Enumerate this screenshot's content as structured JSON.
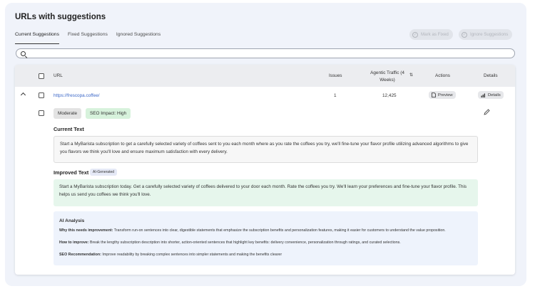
{
  "page": {
    "title": "URLs with suggestions"
  },
  "tabs": [
    "Current Suggestions",
    "Fixed Suggestions",
    "Ignored Suggestions"
  ],
  "actions": {
    "mark_fixed": "Mark as Fixed",
    "ignore": "Ignore Suggestions"
  },
  "table": {
    "columns": {
      "url": "URL",
      "issues": "Issues",
      "traffic_line1": "Agentic Traffic (4",
      "traffic_line2": "Weeks)",
      "actions": "Actions",
      "details": "Details"
    },
    "row": {
      "url": "https://frescopa.coffee/",
      "issues": "1",
      "traffic": "12,425",
      "preview": "Preview",
      "details": "Details"
    }
  },
  "expanded": {
    "severity": "Moderate",
    "impact": "SEO Impact: High",
    "current_heading": "Current Text",
    "current_text": "Start a MyBarista subscription to get a carefully selected variety of coffees sent to you each month where as you rate the coffees you try, we'll fine-tune your flavor profile utilizing advanced algorithms to give you flavors we think you'll love and ensure maximum satisfaction with every delivery.",
    "improved_heading": "Improved Text",
    "ai_tag": "AI-Generated",
    "improved_text": "Start a MyBarista subscription today. Get a carefully selected variety of coffees delivered to your door each month. Rate the coffees you try. We'll learn your preferences and fine-tune your flavor profile. This helps us send you coffees we think you'll love.",
    "analysis": {
      "title": "AI Analysis",
      "why_label": "Why this needs improvement:",
      "why_text": "Transform run-on sentences into clear, digestible statements that emphasize the subscription benefits and personalization features, making it easier for customers to understand the value proposition.",
      "how_label": "How to improve:",
      "how_text": "Break the lengthy subscription description into shorter, action-oriented sentences that highlight key benefits: delivery convenience, personalization through ratings, and curated selections.",
      "seo_label": "SEO Recommendation:",
      "seo_text": "Improve readability by breaking complex sentences into simpler statements and making the benefits clearer"
    }
  },
  "colors": {
    "link": "#3a66c7",
    "impact_bg": "#d7f2dc",
    "improved_bg": "#e6f6ec",
    "analysis_bg": "#eef3fc"
  },
  "icons": [
    "search-icon",
    "check-circle-icon",
    "chevron-up-icon",
    "sort-icon",
    "document-icon",
    "bar-chart-icon",
    "pencil-icon"
  ]
}
